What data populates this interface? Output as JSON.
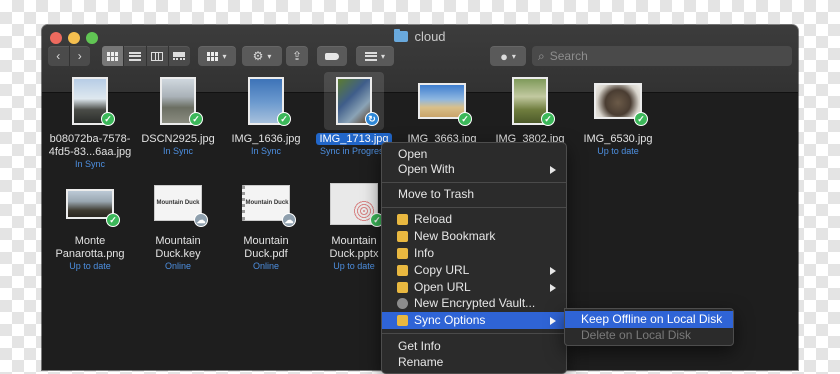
{
  "window": {
    "title": "cloud"
  },
  "toolbar": {
    "search_placeholder": "Search"
  },
  "files": [
    {
      "name": "b08072ba-7578-4fd5-83...6aa.jpg",
      "status": "In Sync",
      "badge": "synced"
    },
    {
      "name": "DSCN2925.jpg",
      "status": "In Sync",
      "badge": "synced"
    },
    {
      "name": "IMG_1636.jpg",
      "status": "In Sync",
      "badge": "synced"
    },
    {
      "name": "IMG_1713.jpg",
      "status": "Sync in Progress",
      "badge": "syncing"
    },
    {
      "name": "IMG_3663.jpg",
      "status": "",
      "badge": "synced"
    },
    {
      "name": "IMG_3802.jpg",
      "status": "",
      "badge": "synced"
    },
    {
      "name": "IMG_6530.jpg",
      "status": "Up to date",
      "badge": "synced"
    },
    {
      "name": "Monte Panarotta.png",
      "status": "Up to date",
      "badge": "synced"
    },
    {
      "name": "Mountain Duck.key",
      "status": "Online",
      "badge": "cloud"
    },
    {
      "name": "Mountain Duck.pdf",
      "status": "Online",
      "badge": "cloud"
    },
    {
      "name": "Mountain Duck.pptx",
      "status": "Up to date",
      "badge": "synced"
    }
  ],
  "doc_thumb_text": "Mountain Duck",
  "context_menu": {
    "open": "Open",
    "open_with": "Open With",
    "move_to_trash": "Move to Trash",
    "reload": "Reload",
    "new_bookmark": "New Bookmark",
    "info": "Info",
    "copy_url": "Copy URL",
    "open_url": "Open URL",
    "new_encrypted_vault": "New Encrypted Vault...",
    "sync_options": "Sync Options",
    "get_info": "Get Info",
    "rename": "Rename"
  },
  "submenu": {
    "keep_offline": "Keep Offline on Local Disk",
    "delete_on_local": "Delete on Local Disk"
  },
  "colors": {
    "accent": "#2f64d6",
    "status_text": "#4d8fe0",
    "badge_synced": "#3cb85a",
    "badge_cloud": "#8fa0ae",
    "badge_syncing": "#2e88d8",
    "menu_item_icon": "#e9b840"
  },
  "icons": {
    "file_badges": [
      "checkmark-icon",
      "cloud-icon",
      "sync-arrows-icon"
    ],
    "menu_items": "mountain-duck-icon",
    "vault": "vault-icon",
    "submenu_arrow": "chevron-right-icon"
  }
}
